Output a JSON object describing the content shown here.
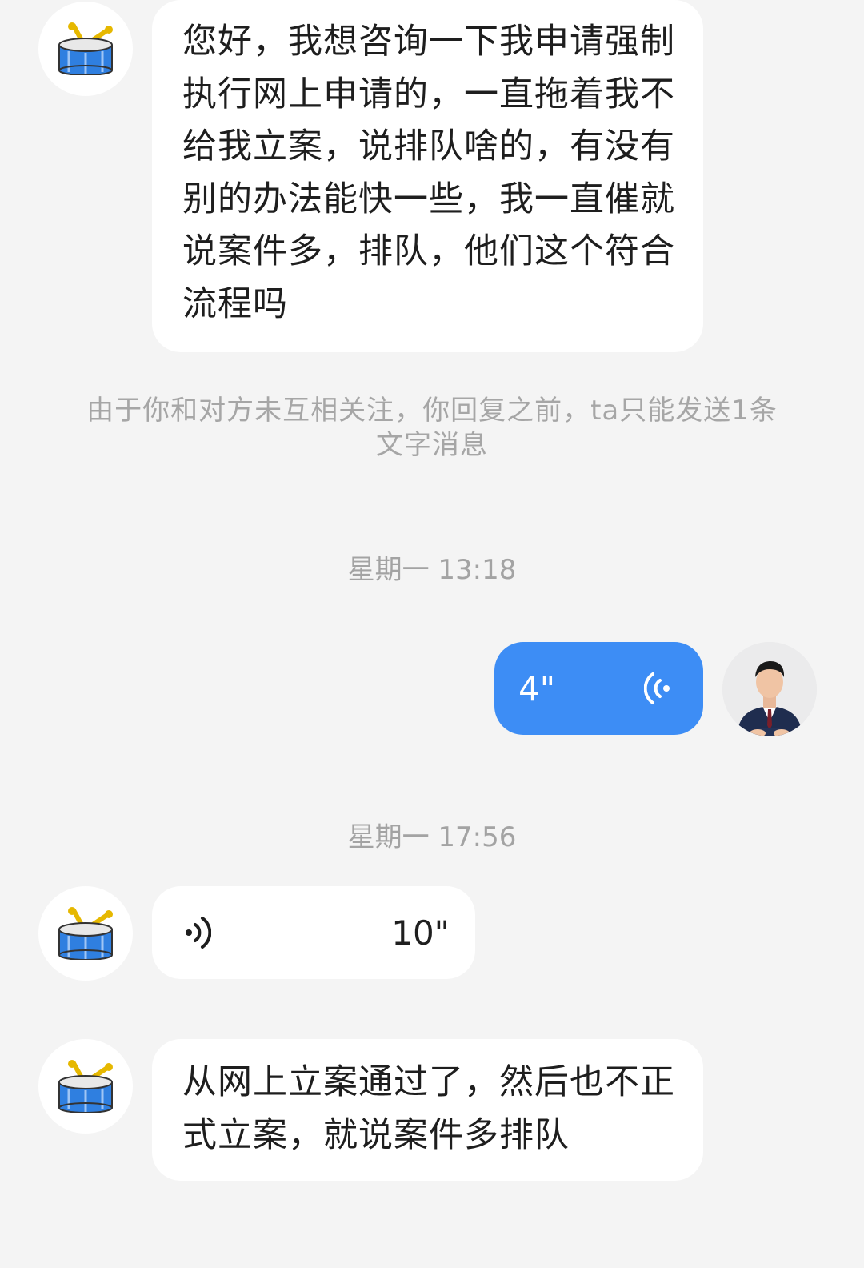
{
  "messages": {
    "first": {
      "text": "您好，我想咨询一下我申请强制执行网上申请的，一直拖着我不给我立案，说排队啥的，有没有别的办法能快一些，我一直催就说案件多，排队，他们这个符合流程吗",
      "avatar_icon": "drum-icon"
    },
    "system_note": "由于你和对方未互相关注，你回复之前，ta只能发送1条文字消息",
    "time1": "星期一 13:18",
    "outgoing_voice": {
      "duration": "4\"",
      "icon": "voice-wave-icon",
      "avatar": "user-photo"
    },
    "time2": "星期一 17:56",
    "incoming_voice": {
      "duration": "10\"",
      "icon": "voice-wave-icon",
      "avatar_icon": "drum-icon"
    },
    "last": {
      "text": "从网上立案通过了，然后也不正式立案，就说案件多排队",
      "avatar_icon": "drum-icon"
    }
  },
  "colors": {
    "background": "#f4f4f4",
    "bubble_in": "#ffffff",
    "bubble_out": "#3d8df5",
    "meta_text": "#a6a6a6"
  }
}
